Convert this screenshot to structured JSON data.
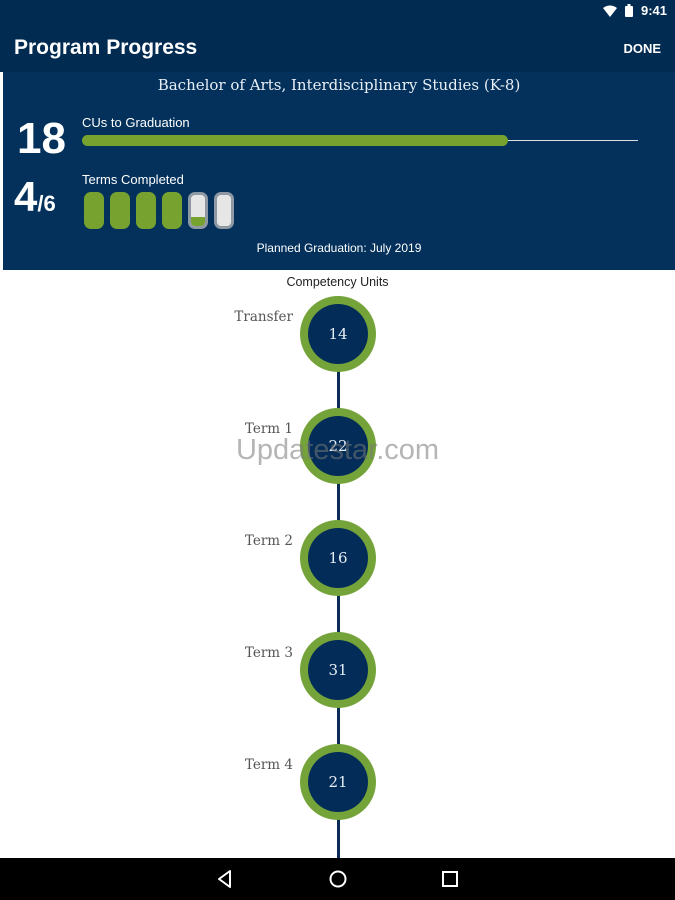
{
  "status_bar": {
    "time": "9:41",
    "icons": [
      "wifi-icon",
      "battery-icon"
    ]
  },
  "app_bar": {
    "title": "Program Progress",
    "done_label": "DONE"
  },
  "summary": {
    "degree": "Bachelor of Arts, Interdisciplinary Studies (K-8)",
    "cus_to_graduation": "18",
    "cus_label": "CUs to Graduation",
    "cus_progress_fraction": 0.87,
    "terms_completed": "4",
    "terms_total": "/6",
    "terms_label": "Terms Completed",
    "term_pills": [
      {
        "state": "done",
        "fill": 1.0
      },
      {
        "state": "done",
        "fill": 1.0
      },
      {
        "state": "done",
        "fill": 1.0
      },
      {
        "state": "done",
        "fill": 1.0
      },
      {
        "state": "progress",
        "fill": 0.3
      },
      {
        "state": "empty",
        "fill": 0.0
      }
    ],
    "planned_graduation": "Planned Graduation: July 2019"
  },
  "competency": {
    "title": "Competency Units",
    "milestones": [
      {
        "label": "Transfer",
        "units": "14"
      },
      {
        "label": "Term 1",
        "units": "22"
      },
      {
        "label": "Term 2",
        "units": "16"
      },
      {
        "label": "Term 3",
        "units": "31"
      },
      {
        "label": "Term 4",
        "units": "21"
      }
    ]
  },
  "watermark": "Updatestar.com",
  "colors": {
    "navy": "#022b52",
    "green": "#78a22f",
    "node_fill": "#032d58"
  },
  "nav_bar": {
    "icons": [
      "back-icon",
      "home-icon",
      "recents-icon"
    ]
  }
}
